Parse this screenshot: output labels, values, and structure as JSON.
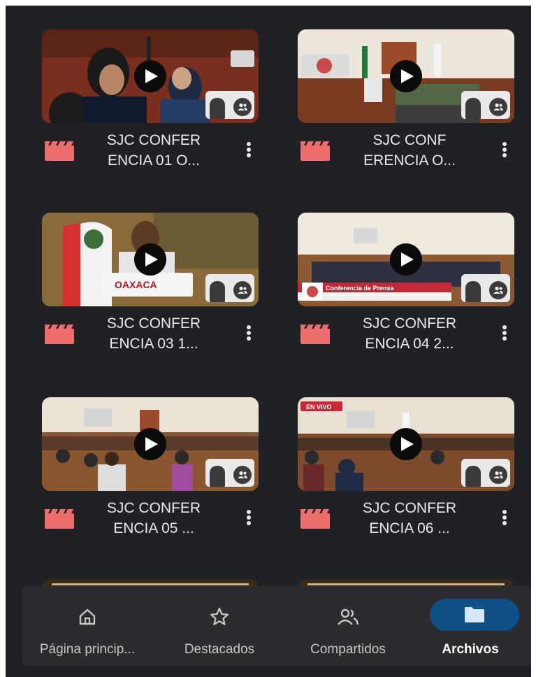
{
  "files": [
    {
      "title_line1": "SJC CONFER",
      "title_line2": "ENCIA 01 O..."
    },
    {
      "title_line1": "SJC CONF",
      "title_line2": "ERENCIA O..."
    },
    {
      "title_line1": "SJC CONFER",
      "title_line2": "ENCIA 03 1..."
    },
    {
      "title_line1": "SJC CONFER",
      "title_line2": "ENCIA 04 2..."
    },
    {
      "title_line1": "SJC CONFER",
      "title_line2": "ENCIA 05 ..."
    },
    {
      "title_line1": "SJC CONFER",
      "title_line2": "ENCIA 06 ..."
    }
  ],
  "thumbnail_overlays": {
    "card3_banner": "OAXACA",
    "card4_banner": "Conferencia de Prensa",
    "card6_badge": "EN VIVO"
  },
  "bottom_nav": [
    {
      "label": "Página princip...",
      "icon": "home-icon",
      "active": false
    },
    {
      "label": "Destacados",
      "icon": "star-icon",
      "active": false
    },
    {
      "label": "Compartidos",
      "icon": "people-icon",
      "active": false
    },
    {
      "label": "Archivos",
      "icon": "folder-icon",
      "active": true
    }
  ],
  "colors": {
    "background": "#202124",
    "video_icon": "#ee6d6d",
    "active_pill": "#0f5086",
    "nav_bar": "#2b2c2f"
  }
}
